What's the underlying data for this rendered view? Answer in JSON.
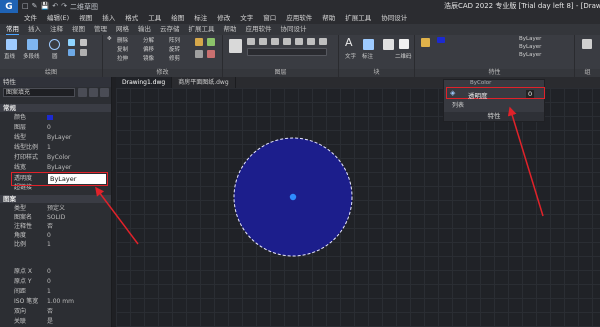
{
  "titlebar": {
    "logo": "G",
    "title": "浩辰CAD 2022 专业版 [Trial day left 8] - [Drawing1",
    "quick_access": [
      "□",
      "✎",
      "💾",
      "↶",
      "↷",
      "二维草图"
    ]
  },
  "menu": [
    "文件",
    "编辑(E)",
    "视图",
    "插入",
    "格式",
    "工具",
    "绘图",
    "标注",
    "修改",
    "文字",
    "窗口",
    "应用软件",
    "帮助",
    "扩展工具",
    "协同设计"
  ],
  "ribbon_tabs": [
    "常用",
    "插入",
    "注释",
    "视图",
    "管理",
    "网格",
    "输出",
    "云存储",
    "扩展工具",
    "帮助",
    "应用软件",
    "协同设计"
  ],
  "ribbon": {
    "draw_group": "绘图",
    "modify_group": "修改",
    "layer_group": "图层",
    "block_group": "块",
    "props_group": "特性",
    "group_last": "组",
    "line": "直线",
    "polyline": "多段线",
    "circle": "圆",
    "modify_items": [
      "删除",
      "复制",
      "拉伸",
      "分解",
      "偏移",
      "镜像",
      "阵列",
      "旋转",
      "修剪"
    ],
    "text": "文字",
    "annotation": "标注",
    "qr": "二维码",
    "bylayer": "ByLayer"
  },
  "file_tabs": [
    "Drawing1.dwg",
    "商房平面图纸.dwg"
  ],
  "palette": {
    "title": "特性",
    "selector": "图案填充",
    "sections": {
      "general": "常规",
      "pattern": "图案"
    },
    "general_rows": [
      {
        "k": "颜色",
        "v": ""
      },
      {
        "k": "图层",
        "v": "0"
      },
      {
        "k": "线型",
        "v": "ByLayer"
      },
      {
        "k": "线型比例",
        "v": "1"
      },
      {
        "k": "打印样式",
        "v": "ByColor"
      },
      {
        "k": "线宽",
        "v": "ByLayer"
      },
      {
        "k": "透明度",
        "v": "ByLayer"
      },
      {
        "k": "超链接",
        "v": ""
      }
    ],
    "pattern_rows": [
      {
        "k": "类型",
        "v": "预定义"
      },
      {
        "k": "图案名",
        "v": "SOLID"
      },
      {
        "k": "注释性",
        "v": "否"
      },
      {
        "k": "角度",
        "v": "0"
      },
      {
        "k": "比例",
        "v": "1"
      },
      {
        "k": "原点 X",
        "v": "0"
      },
      {
        "k": "原点 Y",
        "v": "0"
      },
      {
        "k": "间距",
        "v": "1"
      },
      {
        "k": "ISO 笔宽",
        "v": "1.00 mm"
      },
      {
        "k": "双向",
        "v": "否"
      },
      {
        "k": "关联",
        "v": "是"
      },
      {
        "k": "孤岛检测",
        "v": "外部"
      }
    ],
    "transparency_edit": "ByLayer"
  },
  "flyout": {
    "header": "ByColor",
    "label": "透明度",
    "value": "0",
    "list": "列表",
    "group": "特性"
  },
  "colors": {
    "circle_fill": "#1c1e8c",
    "circle_center": "#2e8bff",
    "highlight": "#e0222a",
    "accent": "#4aa3ff"
  }
}
